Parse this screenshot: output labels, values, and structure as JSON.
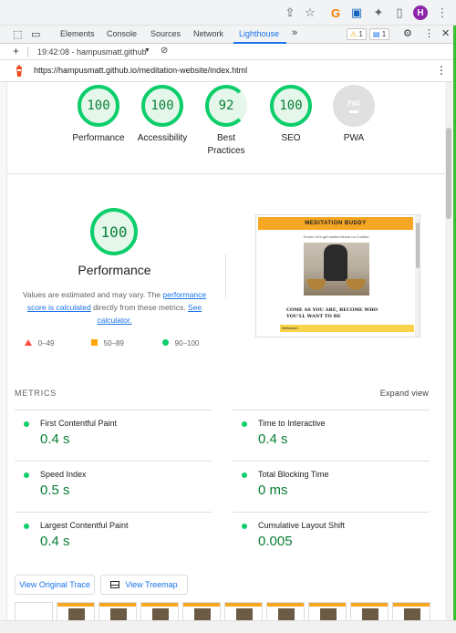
{
  "browser": {
    "avatar_initial": "H"
  },
  "devtools": {
    "tabs": [
      "Elements",
      "Console",
      "Sources",
      "Network",
      "Lighthouse"
    ],
    "more": "»",
    "warnings": "1",
    "messages": "1"
  },
  "report": {
    "time_label": "19:42:08 - hampusmatt.github",
    "url": "https://hampusmatt.github.io/meditation-website/index.html"
  },
  "gauges": [
    {
      "score": "100",
      "label": "Performance"
    },
    {
      "score": "100",
      "label": "Accessibility"
    },
    {
      "score": "92",
      "label": "Best Practices"
    },
    {
      "score": "100",
      "label": "SEO"
    },
    {
      "score": "PWA",
      "label": "PWA"
    }
  ],
  "performance": {
    "score": "100",
    "title": "Performance",
    "desc_1": "Values are estimated and may vary. The ",
    "link_1": "performance score is calculated",
    "desc_2": " directly from these metrics. ",
    "link_2": "See calculator.",
    "legend": [
      "0–49",
      "50–89",
      "90–100"
    ]
  },
  "thumbnail": {
    "header": "MEDITATION BUDDY",
    "nav": "Home     Let's get started     About us     Contact",
    "headline": "COME AS YOU ARE, BECOME WHO YOU'LL WANT TO BE",
    "welcome": "Welcome!"
  },
  "metrics": {
    "heading": "METRICS",
    "expand_label": "Expand view",
    "items": [
      {
        "name": "First Contentful Paint",
        "value": "0.4 s"
      },
      {
        "name": "Time to Interactive",
        "value": "0.4 s"
      },
      {
        "name": "Speed Index",
        "value": "0.5 s"
      },
      {
        "name": "Total Blocking Time",
        "value": "0 ms"
      },
      {
        "name": "Largest Contentful Paint",
        "value": "0.4 s"
      },
      {
        "name": "Cumulative Layout Shift",
        "value": "0.005"
      }
    ]
  },
  "buttons": {
    "original_trace": "View Original Trace",
    "treemap": "View Treemap"
  },
  "colors": {
    "pass": "#0cce6b",
    "average": "#ffa400",
    "fail": "#ff4e42",
    "accent": "#1a73e8"
  }
}
